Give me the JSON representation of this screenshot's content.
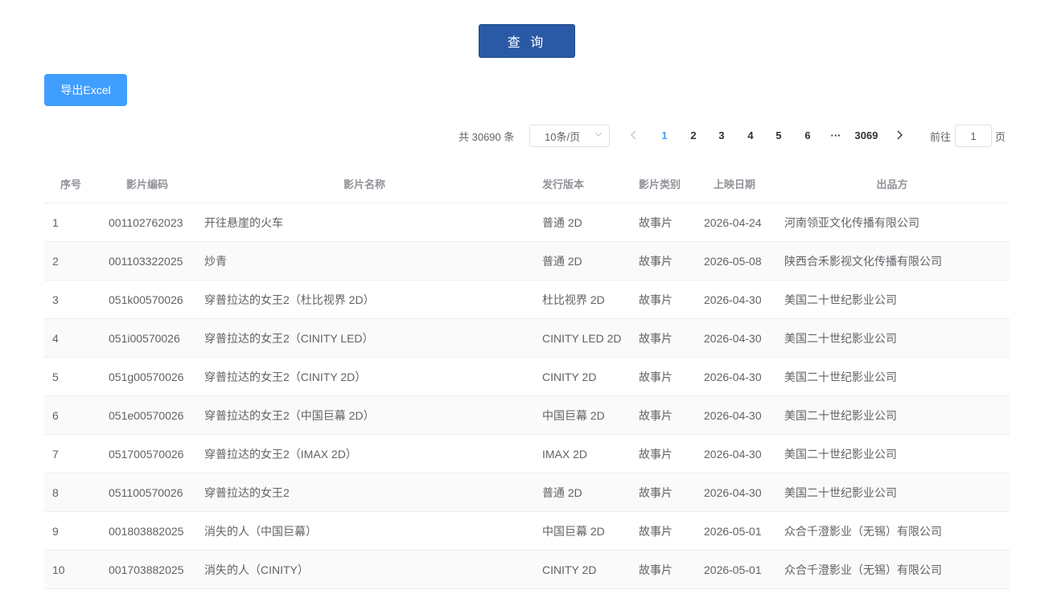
{
  "query_button": "查 询",
  "export_button": "导出Excel",
  "pagination": {
    "total": "共 30690 条",
    "page_size": "10条/页",
    "prev_icon": "chevron-left",
    "next_icon": "chevron-right",
    "pages": [
      "1",
      "2",
      "3",
      "4",
      "5",
      "6"
    ],
    "ellipsis": "···",
    "last_page": "3069",
    "current_page": "1",
    "jump_label": "前往",
    "jump_value": "1",
    "jump_suffix": "页"
  },
  "table": {
    "headers": [
      "序号",
      "影片编码",
      "影片名称",
      "发行版本",
      "影片类别",
      "上映日期",
      "出品方"
    ],
    "rows": [
      [
        "1",
        "001102762023",
        "开往悬崖的火车",
        "普通 2D",
        "故事片",
        "2026-04-24",
        "河南领亚文化传播有限公司"
      ],
      [
        "2",
        "001103322025",
        "炒青",
        "普通 2D",
        "故事片",
        "2026-05-08",
        "陕西合禾影视文化传播有限公司"
      ],
      [
        "3",
        "051k00570026",
        "穿普拉达的女王2（杜比视界 2D）",
        "杜比视界 2D",
        "故事片",
        "2026-04-30",
        "美国二十世纪影业公司"
      ],
      [
        "4",
        "051i00570026",
        "穿普拉达的女王2（CINITY LED）",
        "CINITY LED 2D",
        "故事片",
        "2026-04-30",
        "美国二十世纪影业公司"
      ],
      [
        "5",
        "051g00570026",
        "穿普拉达的女王2（CINITY 2D）",
        "CINITY 2D",
        "故事片",
        "2026-04-30",
        "美国二十世纪影业公司"
      ],
      [
        "6",
        "051e00570026",
        "穿普拉达的女王2（中国巨幕 2D）",
        "中国巨幕 2D",
        "故事片",
        "2026-04-30",
        "美国二十世纪影业公司"
      ],
      [
        "7",
        "051700570026",
        "穿普拉达的女王2（IMAX 2D）",
        "IMAX 2D",
        "故事片",
        "2026-04-30",
        "美国二十世纪影业公司"
      ],
      [
        "8",
        "051100570026",
        "穿普拉达的女王2",
        "普通 2D",
        "故事片",
        "2026-04-30",
        "美国二十世纪影业公司"
      ],
      [
        "9",
        "001803882025",
        "消失的人（中国巨幕）",
        "中国巨幕 2D",
        "故事片",
        "2026-05-01",
        "众合千澄影业（无锡）有限公司"
      ],
      [
        "10",
        "001703882025",
        "消失的人（CINITY）",
        "CINITY 2D",
        "故事片",
        "2026-05-01",
        "众合千澄影业（无锡）有限公司"
      ]
    ]
  }
}
